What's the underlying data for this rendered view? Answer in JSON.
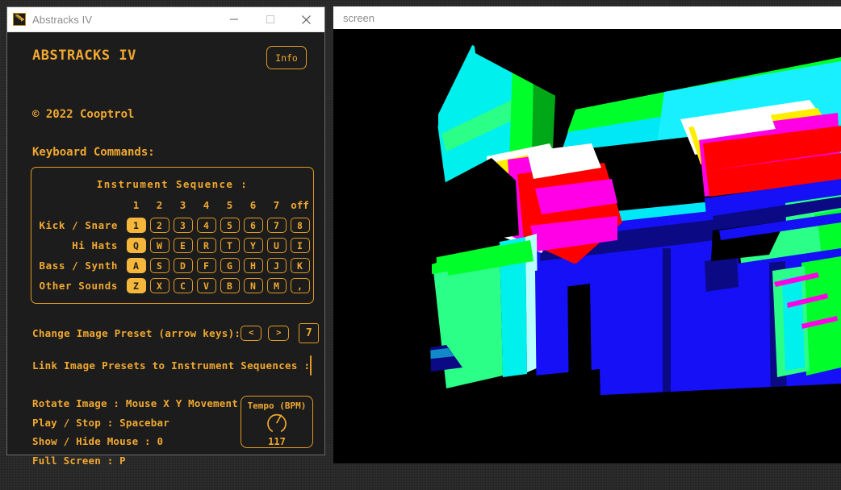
{
  "desktop": {
    "background_color": "#252525"
  },
  "app_window": {
    "title": "Abstracks IV",
    "icon": "app-logo-icon",
    "controls": {
      "minimize": "minimize-icon",
      "maximize": "maximize-icon",
      "close": "close-icon"
    },
    "heading": "ABSTRACKS IV",
    "info_button": "Info",
    "copyright": "© 2022 Cooptrol",
    "section_label": "Keyboard Commands:",
    "accent_color": "#f0a830",
    "panel_bg": "#1c1c1c",
    "keyboard": {
      "title": "Instrument Sequence :",
      "columns": [
        "1",
        "2",
        "3",
        "4",
        "5",
        "6",
        "7",
        "off"
      ],
      "rows": [
        {
          "label": "Kick / Snare",
          "keys": [
            "1",
            "2",
            "3",
            "4",
            "5",
            "6",
            "7",
            "8"
          ],
          "active_index": 0
        },
        {
          "label": "Hi Hats",
          "keys": [
            "Q",
            "W",
            "E",
            "R",
            "T",
            "Y",
            "U",
            "I"
          ],
          "active_index": 0
        },
        {
          "label": "Bass / Synth",
          "keys": [
            "A",
            "S",
            "D",
            "F",
            "G",
            "H",
            "J",
            "K"
          ],
          "active_index": 0
        },
        {
          "label": "Other Sounds",
          "keys": [
            "Z",
            "X",
            "C",
            "V",
            "B",
            "N",
            "M",
            ","
          ],
          "active_index": 0
        }
      ]
    },
    "preset": {
      "label": "Change Image Preset (arrow keys):",
      "prev": "<",
      "next": ">",
      "value": "7"
    },
    "link_presets": {
      "label": "Link Image Presets to Instrument Sequences :",
      "checked": false
    },
    "commands": [
      "Rotate Image : Mouse X Y Movement",
      "Play / Stop : Spacebar",
      "Show / Hide Mouse : 0",
      "Full Screen : P"
    ],
    "tempo": {
      "label": "Tempo (BPM)",
      "value": "117",
      "knob": "tempo-knob-icon"
    }
  },
  "screen_window": {
    "title": "screen",
    "canvas": {
      "background": "#000000",
      "palette": {
        "cyan": "#00ffee",
        "green": "#00ff2a",
        "spring": "#2bff88",
        "blue": "#1510f5",
        "dark_blue": "#0a0a8a",
        "magenta": "#ff00e6",
        "red": "#ff0000",
        "yellow": "#ffee00",
        "white": "#ffffff"
      }
    }
  }
}
